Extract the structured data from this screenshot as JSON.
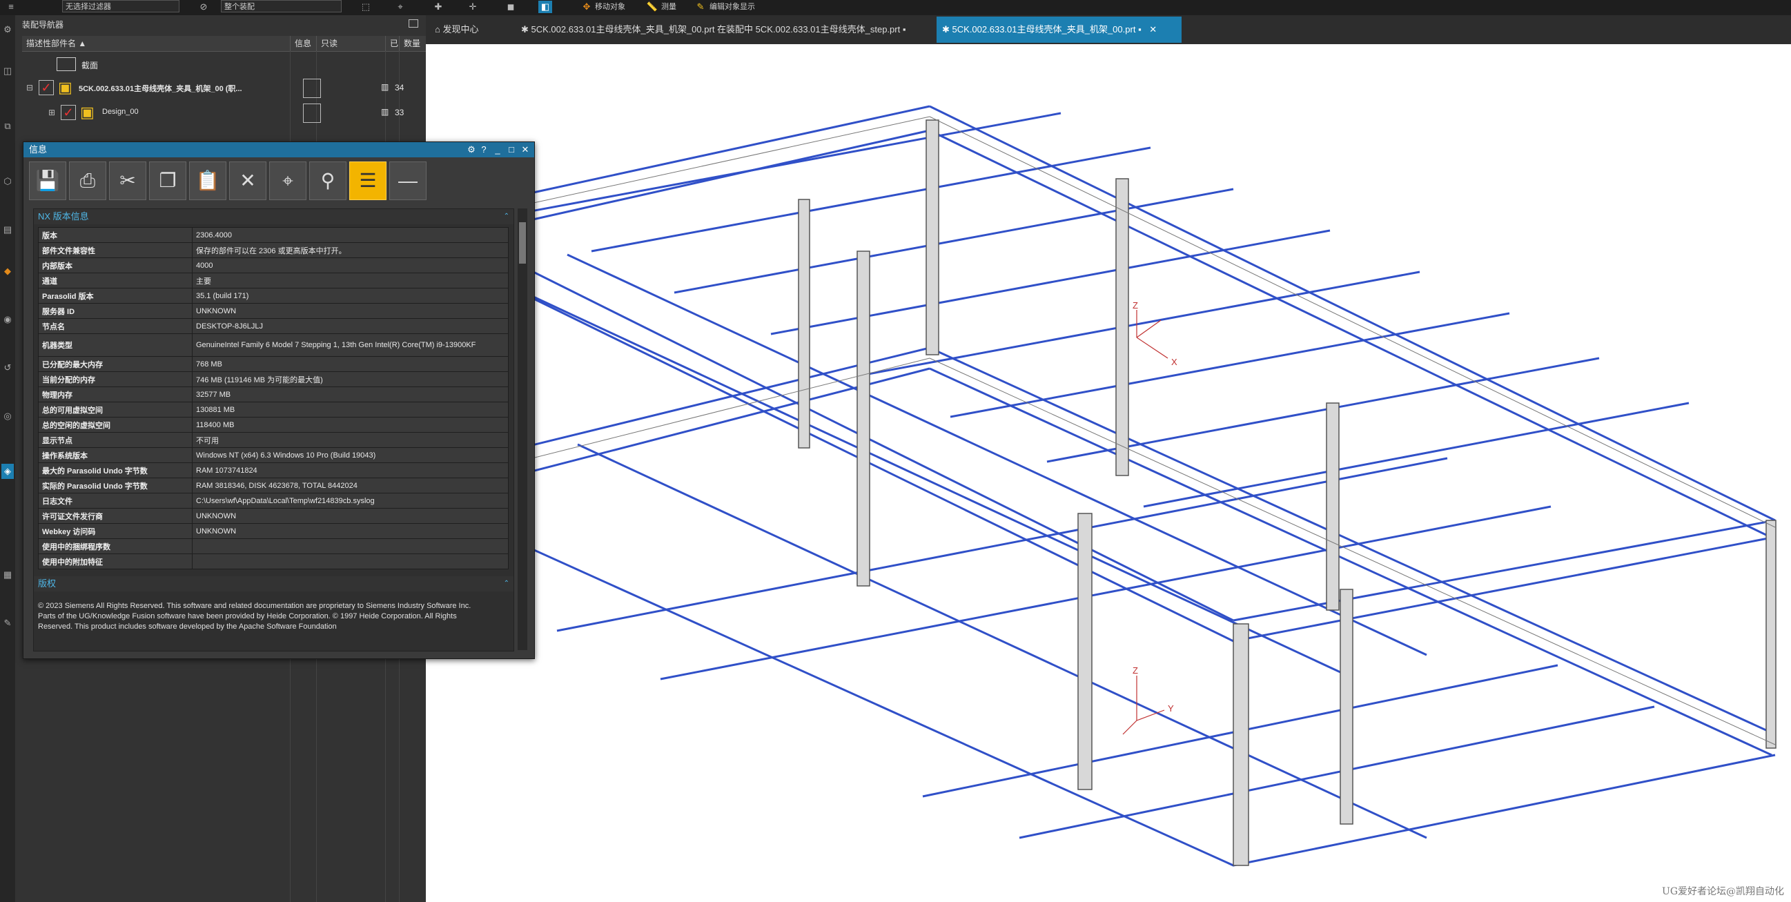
{
  "topbar": {
    "combo1": "无选择过滤器",
    "combo2": "整个装配",
    "btn_move": "移动对象",
    "btn_measure": "测量",
    "btn_display": "编辑对象显示"
  },
  "navigator": {
    "title": "装配导航器",
    "columns": {
      "name": "描述性部件名",
      "info": "信息",
      "readonly": "只读",
      "count_icon": "已",
      "qty": "数量"
    },
    "rows": [
      {
        "name": "截面",
        "qty": ""
      },
      {
        "name": "5CK.002.633.01主母线壳体_夹具_机架_00 (职...",
        "qty": "34"
      },
      {
        "name": "Design_00",
        "qty": "33"
      }
    ]
  },
  "tabs": [
    {
      "label": "发现中心"
    },
    {
      "label": "5CK.002.633.01主母线壳体_夹具_机架_00.prt 在装配中 5CK.002.633.01主母线壳体_step.prt"
    },
    {
      "label": "5CK.002.633.01主母线壳体_夹具_机架_00.prt"
    }
  ],
  "info": {
    "title": "信息",
    "section1": "NX 版本信息",
    "section2": "版权",
    "rows": [
      {
        "k": "版本",
        "v": "2306.4000"
      },
      {
        "k": "部件文件兼容性",
        "v": "保存的部件可以在 2306 或更高版本中打开。"
      },
      {
        "k": "内部版本",
        "v": "4000"
      },
      {
        "k": "通道",
        "v": "主要"
      },
      {
        "k": "Parasolid 版本",
        "v": "35.1 (build 171)"
      },
      {
        "k": "服务器 ID",
        "v": "UNKNOWN"
      },
      {
        "k": "节点名",
        "v": "DESKTOP-8J6LJLJ"
      },
      {
        "k": "机器类型",
        "v": "GenuineIntel Family 6 Model 7 Stepping 1, 13th Gen Intel(R) Core(TM) i9-13900KF"
      },
      {
        "k": "已分配的最大内存",
        "v": "768 MB"
      },
      {
        "k": "当前分配的内存",
        "v": "746 MB (119146 MB 为可能的最大值)"
      },
      {
        "k": "物理内存",
        "v": "32577 MB"
      },
      {
        "k": "总的可用虚拟空间",
        "v": "130881 MB"
      },
      {
        "k": "总的空闲的虚拟空间",
        "v": "118400 MB"
      },
      {
        "k": "显示节点",
        "v": "不可用"
      },
      {
        "k": "操作系统版本",
        "v": "Windows NT (x64) 6.3 Windows 10 Pro (Build 19043)"
      },
      {
        "k": "最大的 Parasolid Undo 字节数",
        "v": "RAM 1073741824"
      },
      {
        "k": "实际的 Parasolid Undo 字节数",
        "v": "RAM 3818346, DISK 4623678, TOTAL 8442024"
      },
      {
        "k": "日志文件",
        "v": "C:\\Users\\wf\\AppData\\Local\\Temp\\wf214839cb.syslog"
      },
      {
        "k": "许可证文件发行商",
        "v": "UNKNOWN"
      },
      {
        "k": "Webkey 访问码",
        "v": "UNKNOWN"
      },
      {
        "k": "使用中的捆绑程序数",
        "v": ""
      },
      {
        "k": "使用中的附加特征",
        "v": ""
      }
    ],
    "copyright": "© 2023 Siemens All Rights Reserved. This software and related documentation are proprietary to Siemens Industry Software Inc. Parts of the UG/Knowledge Fusion software have been provided by Heide Corporation. © 1997 Heide Corporation. All Rights Reserved. This product includes software developed by the Apache Software Foundation"
  },
  "viewport": {
    "watermark": "UG爱好者论坛@凯翔自动化",
    "axis_z": "Z",
    "axis_x": "X",
    "axis_y": "Y"
  }
}
